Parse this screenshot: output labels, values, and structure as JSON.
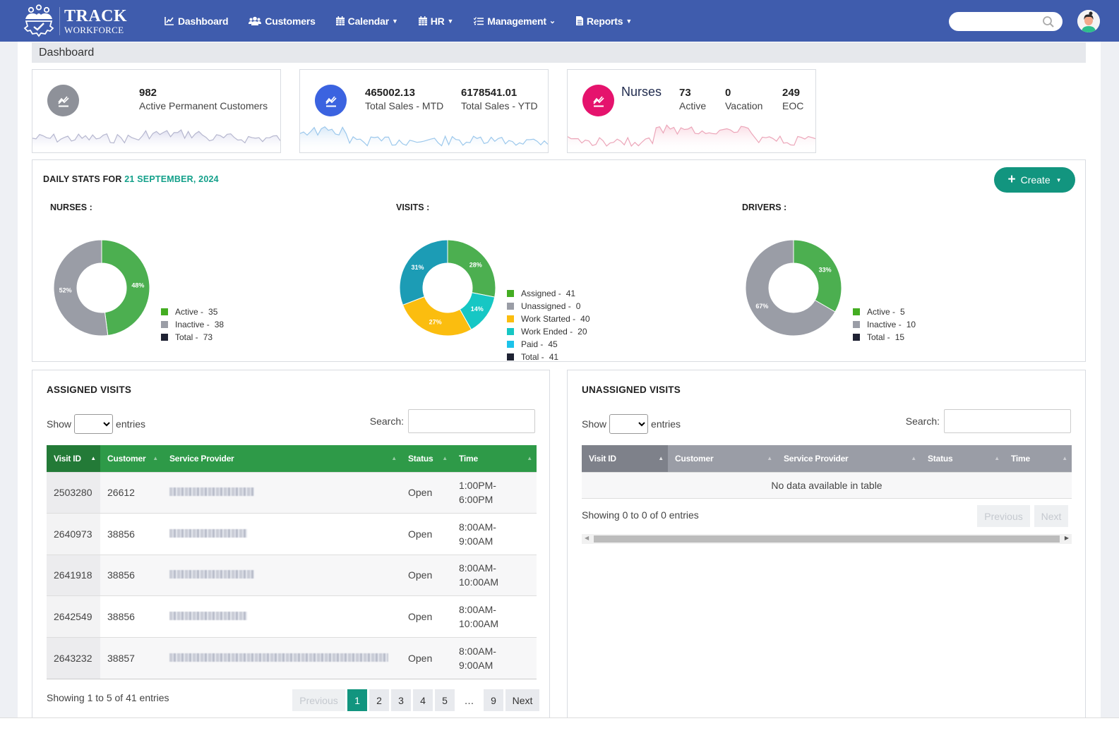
{
  "app": {
    "logo_line1": "TRACK",
    "logo_line2": "WORKFORCE"
  },
  "nav": {
    "items": [
      {
        "label": "Dashboard",
        "icon": "chart-line-icon",
        "has_caret": false
      },
      {
        "label": "Customers",
        "icon": "users-icon",
        "has_caret": false
      },
      {
        "label": "Calendar",
        "icon": "calendar-icon",
        "has_caret": true
      },
      {
        "label": "HR",
        "icon": "calendar-icon",
        "has_caret": true
      },
      {
        "label": "Management",
        "icon": "list-check-icon",
        "has_caret": true
      },
      {
        "label": "Reports",
        "icon": "file-icon",
        "has_caret": true
      }
    ],
    "search_placeholder": "",
    "search_icon": "search-icon",
    "avatar_icon": "user-avatar-icon"
  },
  "breadcrumb": "Dashboard",
  "cards": {
    "customers": {
      "value": "982",
      "label": "Active Permanent Customers",
      "color": "#8e9199"
    },
    "sales": {
      "mtd_value": "465002.13",
      "mtd_label": "Total Sales - MTD",
      "ytd_value": "6178541.01",
      "ytd_label": "Total Sales - YTD",
      "color": "#3b63e0"
    },
    "nurses": {
      "title": "Nurses",
      "active_value": "73",
      "active_label": "Active",
      "vacation_value": "0",
      "vacation_label": "Vacation",
      "eoc_value": "249",
      "eoc_label": "EOC",
      "color": "#e5136d"
    }
  },
  "daily": {
    "title_prefix": "DAILY STATS FOR",
    "date": "21 SEPTEMBER, 2024",
    "create_label": "Create"
  },
  "chart_data": [
    {
      "type": "pie",
      "title": "NURSES :",
      "slices": [
        {
          "label": "Active",
          "value": 35,
          "pct_label": "48%",
          "color": "#4caf50"
        },
        {
          "label": "Inactive",
          "value": 38,
          "pct_label": "52%",
          "color": "#9a9da6"
        }
      ],
      "legend": [
        {
          "label": "Active -",
          "value": "35",
          "color": "#44ad22"
        },
        {
          "label": "Inactive -",
          "value": "38",
          "color": "#9a9da6"
        },
        {
          "label": "Total -",
          "value": "73",
          "color": "#1f2233"
        }
      ]
    },
    {
      "type": "pie",
      "title": "VISITS :",
      "slices": [
        {
          "label": "Assigned",
          "value": 41,
          "pct_label": "28%",
          "color": "#4caf50"
        },
        {
          "label": "Unassigned",
          "value": 0,
          "pct_label": "",
          "color": "#9a9da6"
        },
        {
          "label": "Work Ended",
          "value": 20,
          "pct_label": "14%",
          "color": "#16c7c4"
        },
        {
          "label": "Work Started",
          "value": 40,
          "pct_label": "27%",
          "color": "#fbbd0f"
        },
        {
          "label": "Paid",
          "value": 45,
          "pct_label": "31%",
          "color": "#1c9cb5"
        }
      ],
      "legend": [
        {
          "label": "Assigned -",
          "value": "41",
          "color": "#44ad22"
        },
        {
          "label": "Unassigned -",
          "value": "0",
          "color": "#9a9da6"
        },
        {
          "label": "Work Started -",
          "value": "40",
          "color": "#fbbd0f"
        },
        {
          "label": "Work Ended -",
          "value": "20",
          "color": "#16c7c4"
        },
        {
          "label": "Paid -",
          "value": "45",
          "color": "#1cc3ea"
        },
        {
          "label": "Total -",
          "value": "41",
          "color": "#1f2233"
        }
      ]
    },
    {
      "type": "pie",
      "title": "DRIVERS :",
      "slices": [
        {
          "label": "Active",
          "value": 5,
          "pct_label": "33%",
          "color": "#4caf50"
        },
        {
          "label": "Inactive",
          "value": 10,
          "pct_label": "67%",
          "color": "#9a9da6"
        }
      ],
      "legend": [
        {
          "label": "Active -",
          "value": "5",
          "color": "#44ad22"
        },
        {
          "label": "Inactive -",
          "value": "10",
          "color": "#9a9da6"
        },
        {
          "label": "Total -",
          "value": "15",
          "color": "#1f2233"
        }
      ]
    }
  ],
  "assigned": {
    "title": "ASSIGNED VISITS",
    "show_label": "Show",
    "entries_label": "entries",
    "search_label": "Search:",
    "search_value": "",
    "header_color": "#2e9a48",
    "columns": [
      "Visit ID",
      "Customer",
      "Service Provider",
      "Status",
      "Time"
    ],
    "rows": [
      {
        "visit_id": "2503280",
        "customer": "26612",
        "provider": "[redacted]",
        "status": "Open",
        "time1": "1:00PM-",
        "time2": "6:00PM"
      },
      {
        "visit_id": "2640973",
        "customer": "38856",
        "provider": "[redacted]",
        "status": "Open",
        "time1": "8:00AM-",
        "time2": "9:00AM"
      },
      {
        "visit_id": "2641918",
        "customer": "38856",
        "provider": "[redacted]",
        "status": "Open",
        "time1": "8:00AM-",
        "time2": "10:00AM"
      },
      {
        "visit_id": "2642549",
        "customer": "38856",
        "provider": "[redacted]",
        "status": "Open",
        "time1": "8:00AM-",
        "time2": "10:00AM"
      },
      {
        "visit_id": "2643232",
        "customer": "38857",
        "provider": "[redacted]",
        "status": "Open",
        "time1": "8:00AM-",
        "time2": "9:00AM"
      }
    ],
    "info": "Showing 1 to 5 of 41 entries",
    "pager": [
      "Previous",
      "1",
      "2",
      "3",
      "4",
      "5",
      "…",
      "9",
      "Next"
    ],
    "current_page": "1"
  },
  "unassigned": {
    "title": "UNASSIGNED VISITS",
    "show_label": "Show",
    "entries_label": "entries",
    "search_label": "Search:",
    "search_value": "",
    "header_color": "#9a9da6",
    "columns": [
      "Visit ID",
      "Customer",
      "Service Provider",
      "Status",
      "Time"
    ],
    "empty_text": "No data available in table",
    "info": "Showing 0 to 0 of 0 entries",
    "prev_label": "Previous",
    "next_label": "Next"
  }
}
